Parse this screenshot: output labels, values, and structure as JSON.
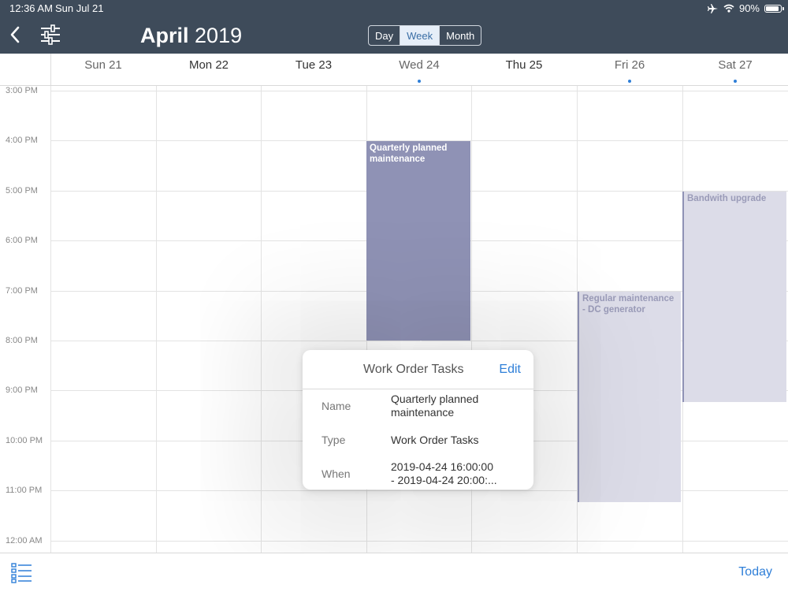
{
  "status": {
    "time": "12:36 AM",
    "date": "Sun Jul 21",
    "battery": "90%"
  },
  "header": {
    "month": "April",
    "year": "2019",
    "view_options": [
      "Day",
      "Week",
      "Month"
    ],
    "selected_view": "Week"
  },
  "days": [
    {
      "label": "Sun 21",
      "has_events": false
    },
    {
      "label": "Mon 22",
      "has_events": false
    },
    {
      "label": "Tue 23",
      "has_events": false
    },
    {
      "label": "Wed 24",
      "has_events": true
    },
    {
      "label": "Thu 25",
      "has_events": false
    },
    {
      "label": "Fri 26",
      "has_events": true
    },
    {
      "label": "Sat 27",
      "has_events": true
    }
  ],
  "time_labels": [
    "3:00 PM",
    "4:00 PM",
    "5:00 PM",
    "6:00 PM",
    "7:00 PM",
    "8:00 PM",
    "9:00 PM",
    "10:00 PM",
    "11:00 PM",
    "12:00 AM"
  ],
  "events": [
    {
      "title": "Quarterly planned maintenance",
      "day": "Wed 24",
      "start": "4:00 PM",
      "end": "8:00 PM"
    },
    {
      "title": "Regular maintenance - DC generator",
      "day": "Fri 26",
      "start": "7:00 PM",
      "end": "11:15 PM"
    },
    {
      "title": "Bandwith upgrade",
      "day": "Sat 27",
      "start": "5:00 PM",
      "end": "9:15 PM"
    }
  ],
  "popover": {
    "title": "Work Order Tasks",
    "edit_label": "Edit",
    "name_label": "Name",
    "name_value": "Quarterly planned maintenance",
    "type_label": "Type",
    "type_value": "Work Order Tasks",
    "when_label": "When",
    "when_line1": "2019-04-24 16:00:00",
    "when_line2": "- 2019-04-24 20:00:..."
  },
  "footer": {
    "today_label": "Today"
  },
  "colors": {
    "header_bg": "#3e4b5a",
    "accent": "#2f7fd8",
    "event_primary": "#8f92b5",
    "event_secondary": "#dcdce8"
  }
}
